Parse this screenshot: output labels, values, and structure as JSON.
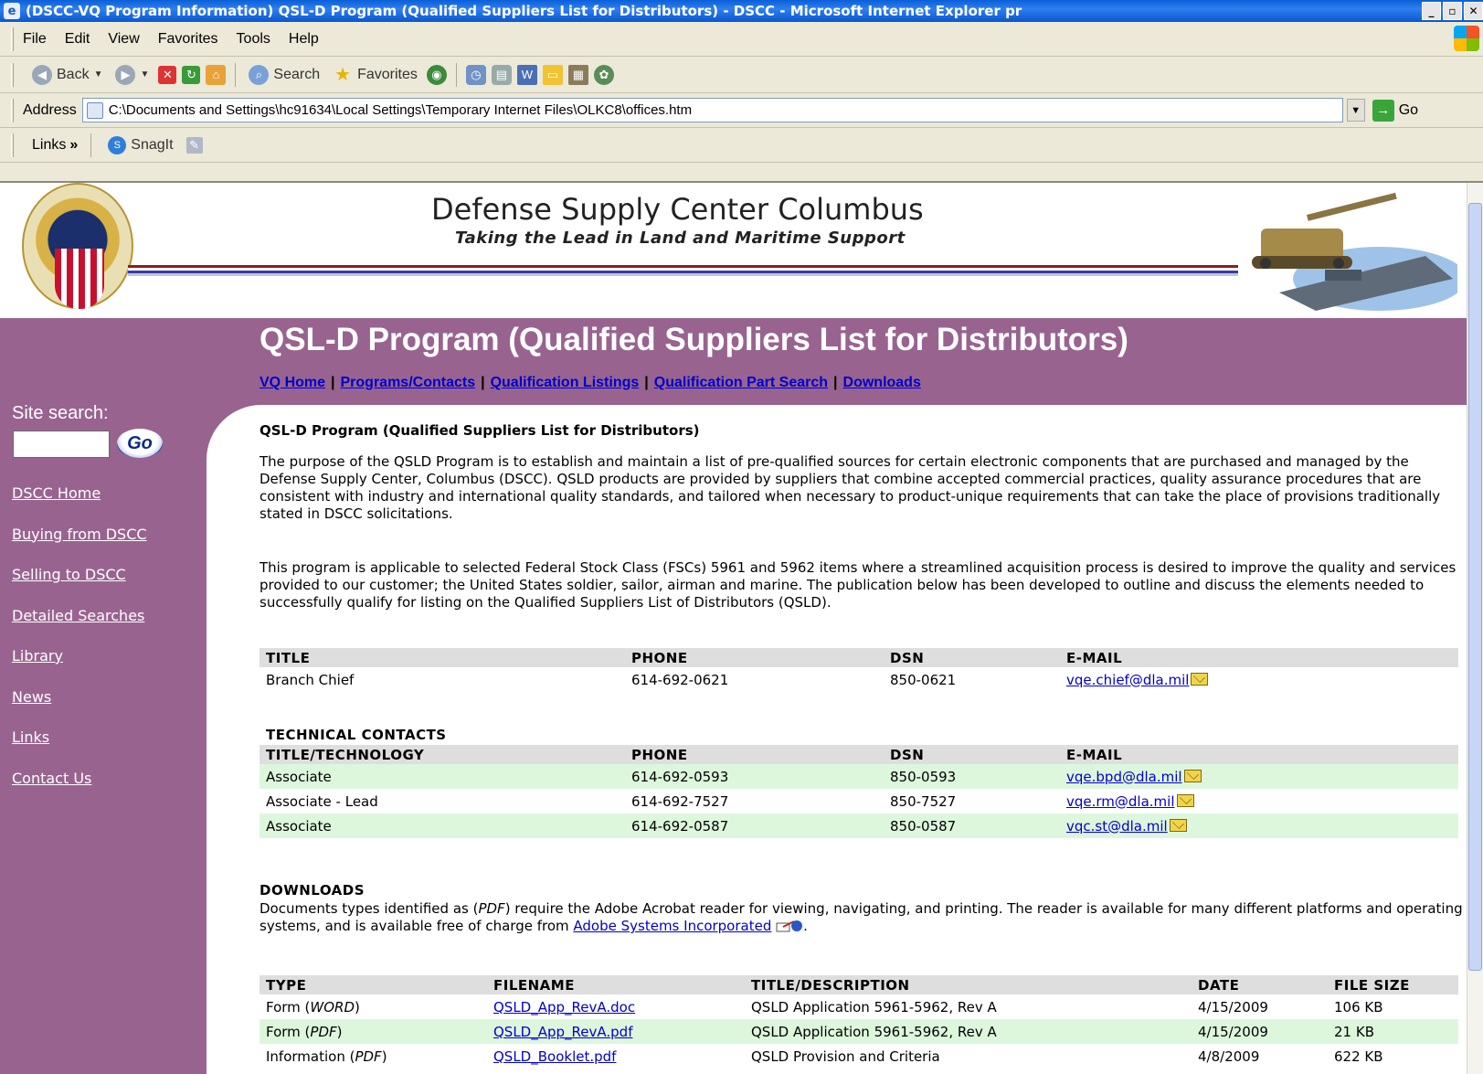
{
  "window": {
    "title": "(DSCC-VQ Program Information) QSL-D Program (Qualified Suppliers List for Distributors) - DSCC - Microsoft Internet Explorer pr",
    "controls": [
      "_",
      "▫",
      "✕"
    ]
  },
  "menu": [
    "File",
    "Edit",
    "View",
    "Favorites",
    "Tools",
    "Help"
  ],
  "toolbar": {
    "back": "Back",
    "search": "Search",
    "favorites": "Favorites"
  },
  "address": {
    "label": "Address",
    "url": "C:\\Documents and Settings\\hc91634\\Local Settings\\Temporary Internet Files\\OLKC8\\offices.htm",
    "go": "Go"
  },
  "links_bar": {
    "label": "Links",
    "chevron": "»",
    "snagit": "SnagIt"
  },
  "site": {
    "title": "Defense Supply Center Columbus",
    "tagline": "Taking the Lead in Land and Maritime Support"
  },
  "page": {
    "heading": "QSL-D Program (Qualified Suppliers List for Distributors)",
    "subnav": [
      "VQ Home",
      "Programs/Contacts",
      "Qualification Listings",
      "Qualification Part Search",
      "Downloads"
    ],
    "section_title": "QSL-D Program (Qualified Suppliers List for Distributors)",
    "para1": "The purpose of the QSLD Program is to establish and maintain a list of pre-qualified sources for certain electronic components that are purchased and managed by the Defense Supply Center, Columbus (DSCC). QSLD products are provided by suppliers that combine accepted commercial practices, quality assurance procedures that are consistent with industry and international quality standards, and tailored when necessary to product-unique requirements that can take the place of provisions traditionally stated in DSCC solicitations.",
    "para2": "This program is applicable to selected Federal Stock Class (FSCs) 5961 and 5962 items where a streamlined acquisition process is desired to improve the quality and services provided to our customer; the United States soldier, sailor, airman and marine. The publication below has been developed to outline and discuss the elements needed to successfully qualify for listing on the Qualified Suppliers List of Distributors (QSLD)."
  },
  "sidebar": {
    "search_label": "Site search:",
    "search_button": "Go",
    "links": [
      "DSCC Home",
      "Buying from DSCC",
      "Selling to DSCC",
      "Detailed Searches",
      "Library",
      "News",
      "Links",
      "Contact Us"
    ]
  },
  "contacts": {
    "headers": [
      "TITLE",
      "PHONE",
      "DSN",
      "E-MAIL"
    ],
    "rows": [
      [
        "Branch Chief",
        "614-692-0621",
        "850-0621",
        "vqe.chief@dla.mil"
      ]
    ]
  },
  "technical": {
    "label": "TECHNICAL CONTACTS",
    "headers": [
      "TITLE/TECHNOLOGY",
      "PHONE",
      "DSN",
      "E-MAIL"
    ],
    "rows": [
      [
        "Associate",
        "614-692-0593",
        "850-0593",
        "vqe.bpd@dla.mil"
      ],
      [
        "Associate - Lead",
        "614-692-7527",
        "850-7527",
        "vqe.rm@dla.mil"
      ],
      [
        "Associate",
        "614-692-0587",
        "850-0587",
        "vqc.st@dla.mil"
      ]
    ]
  },
  "downloads": {
    "title": "DOWNLOADS",
    "text_before": "Documents types identified as (",
    "pdf_word": "PDF",
    "text_after": ") require the Adobe Acrobat reader for viewing, navigating, and printing. The reader is available for many different platforms and operating systems, and is available free of charge from ",
    "adobe_link": "Adobe Systems Incorporated",
    "period": ".",
    "headers": [
      "TYPE",
      "FILENAME",
      "TITLE/DESCRIPTION",
      "DATE",
      "FILE SIZE"
    ],
    "rows": [
      {
        "type": "Form (",
        "type_fmt": "WORD",
        "type_end": ")",
        "file": "QSLD_App_RevA.doc",
        "desc": "QSLD Application 5961-5962, Rev A",
        "date": "4/15/2009",
        "size": "106 KB"
      },
      {
        "type": "Form (",
        "type_fmt": "PDF",
        "type_end": ")",
        "file": "QSLD_App_RevA.pdf",
        "desc": "QSLD Application 5961-5962, Rev A",
        "date": "4/15/2009",
        "size": "21 KB"
      },
      {
        "type": "Information (",
        "type_fmt": "PDF",
        "type_end": ")",
        "file": "QSLD_Booklet.pdf",
        "desc": "QSLD Provision and Criteria",
        "date": "4/8/2009",
        "size": "622 KB"
      }
    ]
  },
  "colors": {
    "sidebar_band": "#98648f",
    "link": "#0000cc",
    "alt_row": "#ddf7dd",
    "header_row": "#dedede",
    "titlebar": "#0a5fd8"
  }
}
